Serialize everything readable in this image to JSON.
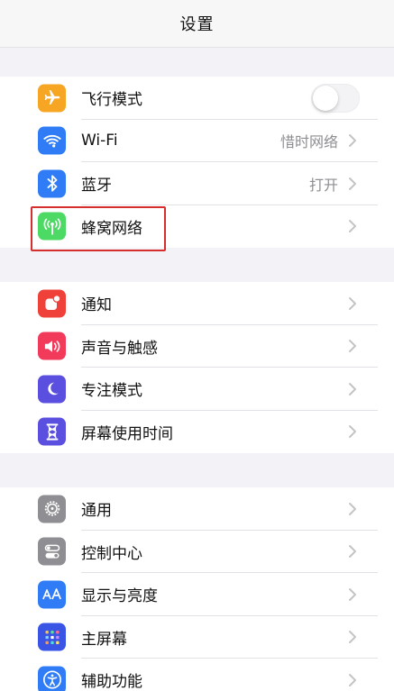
{
  "nav": {
    "title": "设置"
  },
  "groups": [
    {
      "rows": [
        {
          "label": "飞行模式",
          "icon": "airplane-icon",
          "icon_color": "#f6a623",
          "control": "toggle",
          "toggle_on": false
        },
        {
          "label": "Wi-Fi",
          "icon": "wifi-icon",
          "icon_color": "#2f7cf6",
          "value": "惜时网络"
        },
        {
          "label": "蓝牙",
          "icon": "bluetooth-icon",
          "icon_color": "#2f7cf6",
          "value": "打开"
        },
        {
          "label": "蜂窝网络",
          "icon": "cellular-icon",
          "icon_color": "#4cd964",
          "highlighted": true,
          "highlight_color": "#d62d2d"
        }
      ]
    },
    {
      "rows": [
        {
          "label": "通知",
          "icon": "notification-icon",
          "icon_color": "#f0403a"
        },
        {
          "label": "声音与触感",
          "icon": "speaker-icon",
          "icon_color": "#f23a5b"
        },
        {
          "label": "专注模式",
          "icon": "moon-icon",
          "icon_color": "#5b4fe0"
        },
        {
          "label": "屏幕使用时间",
          "icon": "hourglass-icon",
          "icon_color": "#5b4fe0"
        }
      ]
    },
    {
      "rows": [
        {
          "label": "通用",
          "icon": "gear-icon",
          "icon_color": "#8e8e93"
        },
        {
          "label": "控制中心",
          "icon": "toggles-icon",
          "icon_color": "#8e8e93"
        },
        {
          "label": "显示与亮度",
          "icon": "text-size-icon",
          "icon_color": "#2f7cf6"
        },
        {
          "label": "主屏幕",
          "icon": "home-screen-icon",
          "icon_color": "#3a55e6"
        },
        {
          "label": "辅助功能",
          "icon": "accessibility-icon",
          "icon_color": "#2f7cf6"
        }
      ]
    }
  ]
}
